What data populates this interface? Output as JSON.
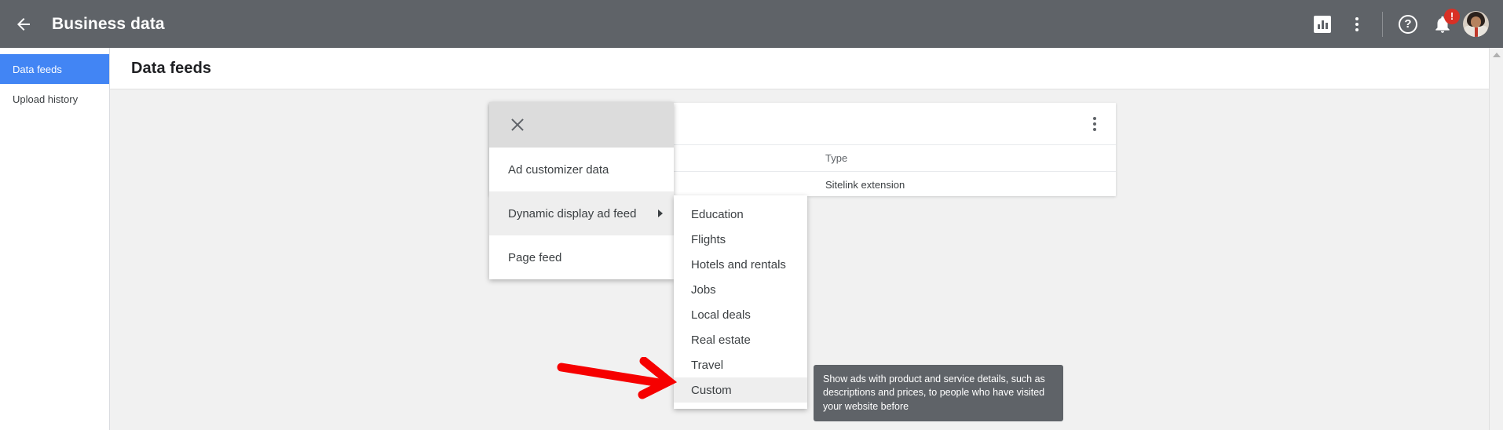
{
  "topbar": {
    "back_icon": "back-arrow-icon",
    "title": "Business data",
    "icons": [
      {
        "name": "reports-icon",
        "label": "Reports"
      },
      {
        "name": "more-options-icon",
        "label": "More options"
      },
      {
        "name": "help-icon",
        "label": "?"
      },
      {
        "name": "notifications-icon",
        "label": "Notifications"
      }
    ],
    "help_glyph": "?",
    "notification_badge": "!",
    "avatar_name": "user-avatar"
  },
  "sidebar": {
    "items": [
      {
        "label": "Data feeds",
        "active": true
      },
      {
        "label": "Upload history",
        "active": false
      }
    ]
  },
  "page": {
    "title": "Data feeds"
  },
  "card": {
    "kebab_icon": "card-more-options-icon",
    "table": {
      "headers": [
        "Type"
      ],
      "rows": [
        [
          "Sitelink extension"
        ]
      ]
    }
  },
  "menu": {
    "close_icon": "close-icon",
    "items": [
      {
        "label": "Ad customizer data",
        "hovered": false,
        "has_submenu": false
      },
      {
        "label": "Dynamic display ad feed",
        "hovered": true,
        "has_submenu": true
      },
      {
        "label": "Page feed",
        "hovered": false,
        "has_submenu": false
      }
    ]
  },
  "submenu": {
    "items": [
      {
        "label": "Education",
        "hovered": false
      },
      {
        "label": "Flights",
        "hovered": false
      },
      {
        "label": "Hotels and rentals",
        "hovered": false
      },
      {
        "label": "Jobs",
        "hovered": false
      },
      {
        "label": "Local deals",
        "hovered": false
      },
      {
        "label": "Real estate",
        "hovered": false
      },
      {
        "label": "Travel",
        "hovered": false
      },
      {
        "label": "Custom",
        "hovered": true
      }
    ]
  },
  "tooltip": {
    "text": "Show ads with product and service details, such as descriptions and prices, to people who have visited your website before"
  },
  "annotation": {
    "arrow_color": "#f60000",
    "arrow_name": "red-pointer-arrow"
  },
  "colors": {
    "topbar_bg": "#5f6368",
    "accent_blue": "#4285f4",
    "badge_red": "#d93025",
    "page_bg": "#f1f1f1"
  },
  "scrollbar": {
    "up_arrow": "scroll-up-arrow-icon"
  }
}
